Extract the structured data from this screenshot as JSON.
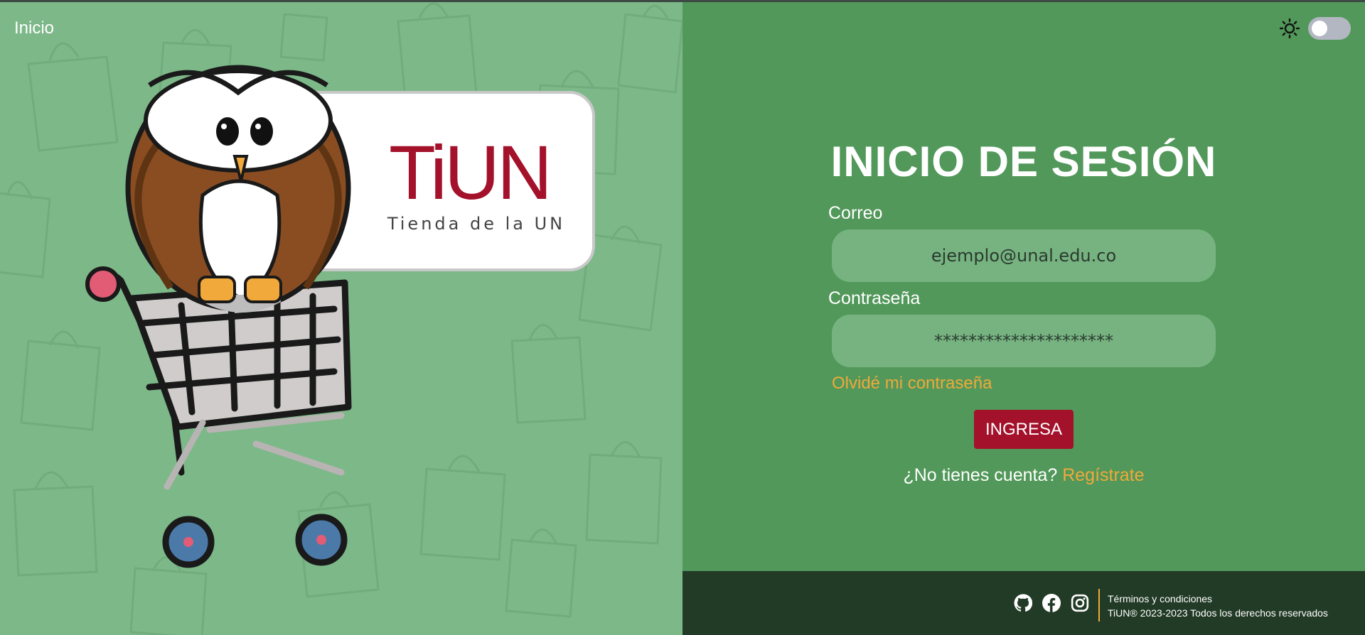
{
  "nav": {
    "home_label": "Inicio"
  },
  "logo": {
    "brand": "TiUN",
    "tagline": "Tienda de la UN"
  },
  "theme_toggle": {
    "mode": "light",
    "icon": "sun-icon"
  },
  "login": {
    "title": "INICIO DE SESIÓN",
    "email_label": "Correo",
    "email_placeholder": "ejemplo@unal.edu.co",
    "password_label": "Contraseña",
    "password_placeholder": "*********************",
    "forgot_link": "Olvidé mi contraseña",
    "submit_label": "INGRESA",
    "no_account_text": "¿No tienes cuenta?",
    "register_link": "Regístrate"
  },
  "footer": {
    "social_icons": [
      "github-icon",
      "facebook-icon",
      "instagram-icon"
    ],
    "terms_link": "Términos y condiciones",
    "copyright": "TiUN® 2023-2023 Todos los derechos reservados"
  },
  "colors": {
    "left_background": "#7db889",
    "right_background": "#52985a",
    "input_background": "#76b380",
    "accent_orange": "#f0a93a",
    "button_red": "#a3112b",
    "footer_background": "#223b26",
    "brand_red": "#a3112b"
  }
}
